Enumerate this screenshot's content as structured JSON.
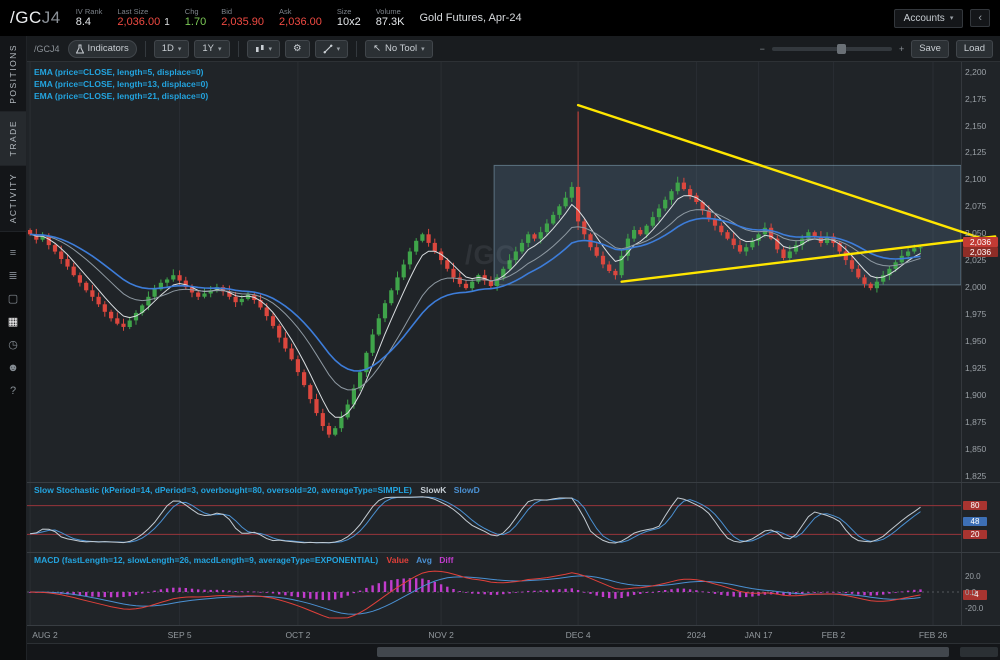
{
  "colors": {
    "up": "#3fa44a",
    "down": "#dc473e",
    "trendline": "#ffe600",
    "value": "#e0403a",
    "avg": "#4a90d2",
    "diff": "#c13ccc",
    "accent": "#23a4df",
    "badge_red": "#c23b34"
  },
  "icons": {
    "chevron_down": "▾",
    "collapse": "‹",
    "cursor": "↖",
    "minus": "−",
    "plus": "+",
    "gear": "⚙",
    "sidebar": [
      {
        "name": "watchlist-icon",
        "glyph": "≡"
      },
      {
        "name": "quotes-icon",
        "glyph": "≣"
      },
      {
        "name": "box-icon",
        "glyph": "▢"
      },
      {
        "name": "grid-icon",
        "glyph": "▦"
      },
      {
        "name": "clock-icon",
        "glyph": "◷"
      },
      {
        "name": "users-icon",
        "glyph": "☻"
      },
      {
        "name": "help-icon",
        "glyph": "?"
      }
    ]
  },
  "header": {
    "symbol_main": "/GC",
    "symbol_sub": "J4",
    "fields": [
      {
        "label": "IV Rank",
        "value": "8.4"
      },
      {
        "label": "Last Size",
        "value": "2,036.00",
        "value2": "1"
      },
      {
        "label": "Chg",
        "value": "1.70"
      },
      {
        "label": "Bid",
        "value": "2,035.90"
      },
      {
        "label": "Ask",
        "value": "2,036.00"
      },
      {
        "label": "Size",
        "value": "10x2"
      },
      {
        "label": "Volume",
        "value": "87.3K"
      }
    ],
    "description": "Gold Futures, Apr-24",
    "accounts_label": "Accounts"
  },
  "sidebar_tabs": [
    {
      "label": "POSITIONS",
      "active": false
    },
    {
      "label": "TRADE",
      "active": true
    },
    {
      "label": "ACTIVITY",
      "active": false
    }
  ],
  "toolbar": {
    "symbol_label": "/GCJ4",
    "indicators_label": "Indicators",
    "timeframe": "1D",
    "range": "1Y",
    "tool_label": "No Tool",
    "save_label": "Save",
    "load_label": "Load"
  },
  "studies": {
    "ema_labels": [
      "EMA (price=CLOSE, length=5, displace=0)",
      "EMA (price=CLOSE, length=13, displace=0)",
      "EMA (price=CLOSE, length=21, displace=0)"
    ],
    "stoch_label": "Slow Stochastic (kPeriod=14, dPeriod=3, overbought=80, oversold=20, averageType=SIMPLE)",
    "stoch_plots": [
      {
        "label": "SlowK"
      },
      {
        "label": "SlowD"
      }
    ],
    "macd_label": "MACD (fastLength=12, slowLength=26, macdLength=9, averageType=EXPONENTIAL)",
    "macd_plots": [
      {
        "label": "Value"
      },
      {
        "label": "Avg"
      },
      {
        "label": "Diff"
      }
    ]
  },
  "chart_data": {
    "type": "candlestick",
    "symbol": "/GCJ4",
    "title": "Gold Futures, Apr-24",
    "timeframe": "1D",
    "range": "1Y",
    "watermark": "/GC",
    "price_axis": {
      "min": 1825,
      "max": 2200,
      "step": 25,
      "ticks": [
        "2,200",
        "2,175",
        "2,150",
        "2,125",
        "2,100",
        "2,075",
        "2,050",
        "2,025",
        "2,000",
        "1,975",
        "1,950",
        "1,925",
        "1,900",
        "1,875",
        "1,850",
        "1,825"
      ]
    },
    "axis_badges": [
      {
        "name": "ask-badge",
        "text": "2,036",
        "price": 2036.0
      },
      {
        "name": "bid-badge",
        "text": "2,036",
        "price": 2035.9
      }
    ],
    "time_axis": [
      {
        "label": "AUG 2",
        "idx": 0
      },
      {
        "label": "SEP 5",
        "idx": 24
      },
      {
        "label": "OCT 2",
        "idx": 43
      },
      {
        "label": "NOV 2",
        "idx": 66
      },
      {
        "label": "DEC 4",
        "idx": 88
      },
      {
        "label": "2024",
        "idx": 107
      },
      {
        "label": "JAN 17",
        "idx": 117
      },
      {
        "label": "FEB 2",
        "idx": 129
      },
      {
        "label": "FEB 26",
        "idx": 145
      }
    ],
    "first_open": 2052,
    "closes": [
      2048,
      2043,
      2046,
      2038,
      2032,
      2025,
      2018,
      2010,
      2003,
      1996,
      1990,
      1983,
      1976,
      1970,
      1965,
      1962,
      1968,
      1975,
      1982,
      1990,
      1997,
      2003,
      2006,
      2010,
      2005,
      1999,
      1994,
      1990,
      1993,
      1996,
      1999,
      1995,
      1990,
      1985,
      1988,
      1992,
      1987,
      1980,
      1972,
      1963,
      1952,
      1942,
      1932,
      1920,
      1908,
      1895,
      1882,
      1870,
      1862,
      1868,
      1878,
      1890,
      1905,
      1920,
      1938,
      1955,
      1970,
      1984,
      1996,
      2008,
      2020,
      2032,
      2042,
      2048,
      2040,
      2032,
      2024,
      2016,
      2008,
      2002,
      1998,
      2004,
      2010,
      2005,
      2000,
      2008,
      2016,
      2024,
      2032,
      2040,
      2048,
      2044,
      2050,
      2058,
      2066,
      2074,
      2082,
      2092,
      2060,
      2048,
      2036,
      2028,
      2020,
      2014,
      2010,
      2028,
      2044,
      2052,
      2048,
      2056,
      2064,
      2072,
      2080,
      2088,
      2096,
      2090,
      2084,
      2078,
      2070,
      2062,
      2056,
      2050,
      2044,
      2038,
      2032,
      2036,
      2042,
      2048,
      2054,
      2044,
      2034,
      2026,
      2032,
      2038,
      2044,
      2050,
      2046,
      2040,
      2046,
      2040,
      2032,
      2024,
      2016,
      2008,
      2002,
      1998,
      2004,
      2010,
      2016,
      2022,
      2028,
      2032,
      2035,
      2036
    ],
    "wick_overrides": {
      "88": [
        2162,
        2052
      ]
    },
    "overlays": {
      "emas": [
        {
          "length": 5,
          "color": "#dadee1"
        },
        {
          "length": 13,
          "color": "#8f9aa3"
        },
        {
          "length": 21,
          "color": "#3d7dda"
        }
      ],
      "trendlines": [
        {
          "name": "upper-trendline",
          "from_idx": 88,
          "from_price": 2168,
          "to_idx": 155,
          "to_price": 2040
        },
        {
          "name": "lower-trendline",
          "from_idx": 95,
          "from_price": 2004,
          "to_idx": 155,
          "to_price": 2046
        }
      ],
      "selection_box": {
        "from_idx": 75,
        "top_price": 2112,
        "bottom_price": 2001
      }
    },
    "stochastic": {
      "overbought": 80,
      "oversold": 20,
      "badges": [
        {
          "text": "80",
          "value": 80,
          "type": "red"
        },
        {
          "text": "48",
          "value": 48,
          "type": "blue"
        },
        {
          "text": "20",
          "value": 20,
          "type": "red"
        }
      ]
    },
    "macd": {
      "axis_labels": [
        {
          "text": "20.0",
          "value": 20
        },
        {
          "text": "0.0",
          "value": 0
        },
        {
          "text": "-20.0",
          "value": -20
        }
      ],
      "badge": {
        "text": "-4",
        "value": -4
      }
    }
  }
}
